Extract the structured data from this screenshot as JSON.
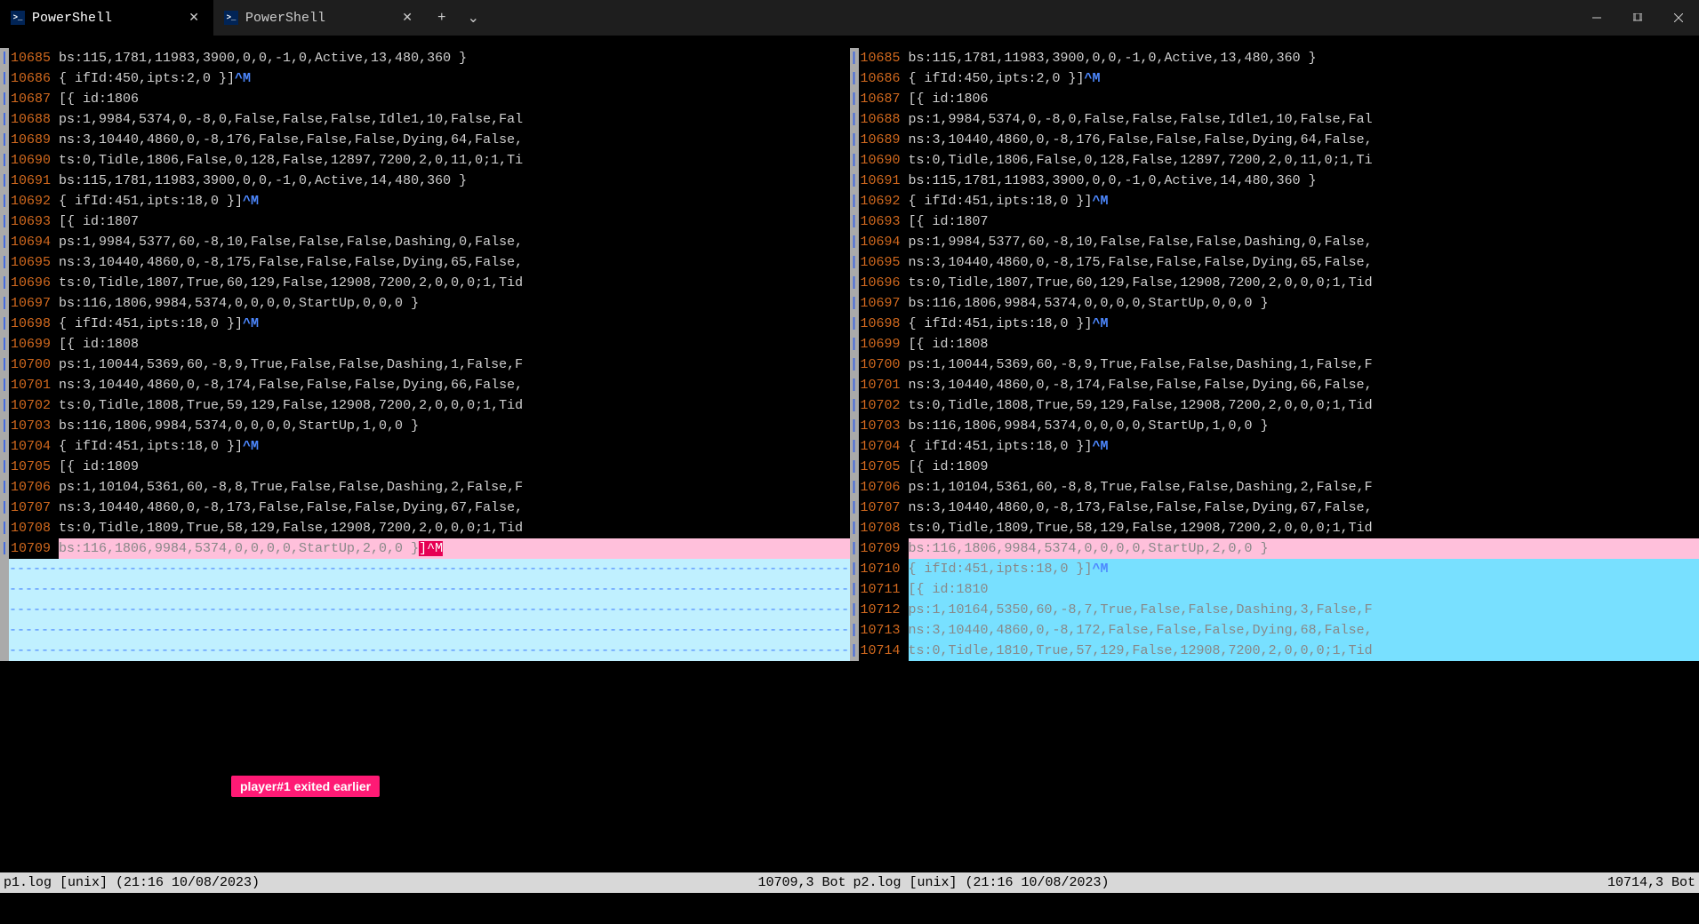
{
  "window": {
    "tabs": [
      {
        "label": "PowerShell",
        "active": true
      },
      {
        "label": "PowerShell",
        "active": false
      }
    ]
  },
  "annotation_text": "player#1 exited earlier",
  "panes": [
    {
      "status_left": "p1.log [unix] (21:16 10/08/2023)",
      "status_right": "10709,3 Bot",
      "lines": [
        {
          "no": "10685",
          "t": "bs:115,1781,11983,3900,0,0,-1,0,Active,13,480,360 }"
        },
        {
          "no": "10686",
          "t": "{ ifId:450,ipts:2,0 }]",
          "cm": "^M"
        },
        {
          "no": "10687",
          "t": "[{ id:1806"
        },
        {
          "no": "10688",
          "t": "ps:1,9984,5374,0,-8,0,False,False,False,Idle1,10,False,Fal"
        },
        {
          "no": "10689",
          "t": "ns:3,10440,4860,0,-8,176,False,False,False,Dying,64,False,"
        },
        {
          "no": "10690",
          "t": "ts:0,Tidle,1806,False,0,128,False,12897,7200,2,0,11,0;1,Ti"
        },
        {
          "no": "10691",
          "t": "bs:115,1781,11983,3900,0,0,-1,0,Active,14,480,360 }"
        },
        {
          "no": "10692",
          "t": "{ ifId:451,ipts:18,0 }]",
          "cm": "^M"
        },
        {
          "no": "10693",
          "t": "[{ id:1807"
        },
        {
          "no": "10694",
          "t": "ps:1,9984,5377,60,-8,10,False,False,False,Dashing,0,False,"
        },
        {
          "no": "10695",
          "t": "ns:3,10440,4860,0,-8,175,False,False,False,Dying,65,False,"
        },
        {
          "no": "10696",
          "t": "ts:0,Tidle,1807,True,60,129,False,12908,7200,2,0,0,0;1,Tid"
        },
        {
          "no": "10697",
          "t": "bs:116,1806,9984,5374,0,0,0,0,StartUp,0,0,0 }"
        },
        {
          "no": "10698",
          "t": "{ ifId:451,ipts:18,0 }]",
          "cm": "^M"
        },
        {
          "no": "10699",
          "t": "[{ id:1808"
        },
        {
          "no": "10700",
          "t": "ps:1,10044,5369,60,-8,9,True,False,False,Dashing,1,False,F"
        },
        {
          "no": "10701",
          "t": "ns:3,10440,4860,0,-8,174,False,False,False,Dying,66,False,"
        },
        {
          "no": "10702",
          "t": "ts:0,Tidle,1808,True,59,129,False,12908,7200,2,0,0,0;1,Tid"
        },
        {
          "no": "10703",
          "t": "bs:116,1806,9984,5374,0,0,0,0,StartUp,1,0,0 }"
        },
        {
          "no": "10704",
          "t": "{ ifId:451,ipts:18,0 }]",
          "cm": "^M"
        },
        {
          "no": "10705",
          "t": "[{ id:1809"
        },
        {
          "no": "10706",
          "t": "ps:1,10104,5361,60,-8,8,True,False,False,Dashing,2,False,F"
        },
        {
          "no": "10707",
          "t": "ns:3,10440,4860,0,-8,173,False,False,False,Dying,67,False,"
        },
        {
          "no": "10708",
          "t": "ts:0,Tidle,1809,True,58,129,False,12908,7200,2,0,0,0;1,Tid"
        },
        {
          "no": "10709",
          "diff": "del",
          "t": "bs:116,1806,9984,5374,0,0,0,0,StartUp,2,0,0 }",
          "suffix_hl": "]^M"
        }
      ],
      "fillers": 5
    },
    {
      "status_left": "p2.log [unix] (21:16 10/08/2023)",
      "status_right": "10714,3 Bot",
      "lines": [
        {
          "no": "10685",
          "t": "bs:115,1781,11983,3900,0,0,-1,0,Active,13,480,360 }"
        },
        {
          "no": "10686",
          "t": "{ ifId:450,ipts:2,0 }]",
          "cm": "^M"
        },
        {
          "no": "10687",
          "t": "[{ id:1806"
        },
        {
          "no": "10688",
          "t": "ps:1,9984,5374,0,-8,0,False,False,False,Idle1,10,False,Fal"
        },
        {
          "no": "10689",
          "t": "ns:3,10440,4860,0,-8,176,False,False,False,Dying,64,False,"
        },
        {
          "no": "10690",
          "t": "ts:0,Tidle,1806,False,0,128,False,12897,7200,2,0,11,0;1,Ti"
        },
        {
          "no": "10691",
          "t": "bs:115,1781,11983,3900,0,0,-1,0,Active,14,480,360 }"
        },
        {
          "no": "10692",
          "t": "{ ifId:451,ipts:18,0 }]",
          "cm": "^M"
        },
        {
          "no": "10693",
          "t": "[{ id:1807"
        },
        {
          "no": "10694",
          "t": "ps:1,9984,5377,60,-8,10,False,False,False,Dashing,0,False,"
        },
        {
          "no": "10695",
          "t": "ns:3,10440,4860,0,-8,175,False,False,False,Dying,65,False,"
        },
        {
          "no": "10696",
          "t": "ts:0,Tidle,1807,True,60,129,False,12908,7200,2,0,0,0;1,Tid"
        },
        {
          "no": "10697",
          "t": "bs:116,1806,9984,5374,0,0,0,0,StartUp,0,0,0 }"
        },
        {
          "no": "10698",
          "t": "{ ifId:451,ipts:18,0 }]",
          "cm": "^M"
        },
        {
          "no": "10699",
          "t": "[{ id:1808"
        },
        {
          "no": "10700",
          "t": "ps:1,10044,5369,60,-8,9,True,False,False,Dashing,1,False,F"
        },
        {
          "no": "10701",
          "t": "ns:3,10440,4860,0,-8,174,False,False,False,Dying,66,False,"
        },
        {
          "no": "10702",
          "t": "ts:0,Tidle,1808,True,59,129,False,12908,7200,2,0,0,0;1,Tid"
        },
        {
          "no": "10703",
          "t": "bs:116,1806,9984,5374,0,0,0,0,StartUp,1,0,0 }"
        },
        {
          "no": "10704",
          "t": "{ ifId:451,ipts:18,0 }]",
          "cm": "^M"
        },
        {
          "no": "10705",
          "t": "[{ id:1809"
        },
        {
          "no": "10706",
          "t": "ps:1,10104,5361,60,-8,8,True,False,False,Dashing,2,False,F"
        },
        {
          "no": "10707",
          "t": "ns:3,10440,4860,0,-8,173,False,False,False,Dying,67,False,"
        },
        {
          "no": "10708",
          "t": "ts:0,Tidle,1809,True,58,129,False,12908,7200,2,0,0,0;1,Tid"
        },
        {
          "no": "10709",
          "diff": "del",
          "t": "bs:116,1806,9984,5374,0,0,0,0,StartUp,2,0,0 }"
        },
        {
          "no": "10710",
          "diff": "add",
          "t": "{ ifId:451,ipts:18,0 }]",
          "cm": "^M"
        },
        {
          "no": "10711",
          "diff": "add",
          "t": "[{ id:1810"
        },
        {
          "no": "10712",
          "diff": "add",
          "t": "ps:1,10164,5350,60,-8,7,True,False,False,Dashing,3,False,F"
        },
        {
          "no": "10713",
          "diff": "add",
          "t": "ns:3,10440,4860,0,-8,172,False,False,False,Dying,68,False,"
        },
        {
          "no": "10714",
          "diff": "add",
          "t": "ts:0,Tidle,1810,True,57,129,False,12908,7200,2,0,0,0;1,Tid"
        }
      ],
      "fillers": 0
    }
  ]
}
